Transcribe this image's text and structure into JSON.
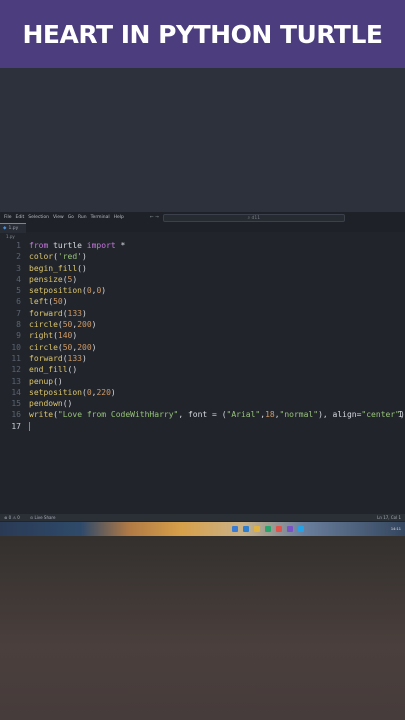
{
  "banner": {
    "title": "HEART IN PYTHON TURTLE"
  },
  "editor": {
    "menu": [
      "File",
      "Edit",
      "Selection",
      "View",
      "Go",
      "Run",
      "Terminal",
      "Help"
    ],
    "command_center": "⌕ d11",
    "tab": "1.py",
    "breadcrumb": "1.py",
    "lines": [
      {
        "n": "1",
        "html": "<span class='kw'>from</span> turtle <span class='kw'>import</span> *"
      },
      {
        "n": "2",
        "html": "<span class='fn'>color</span>(<span class='str'>'red'</span>)"
      },
      {
        "n": "3",
        "html": "<span class='fn'>begin_fill</span>()"
      },
      {
        "n": "4",
        "html": "<span class='fn'>pensize</span>(<span class='num'>5</span>)"
      },
      {
        "n": "5",
        "html": "<span class='fn'>setposition</span>(<span class='num'>0</span>,<span class='num'>0</span>)"
      },
      {
        "n": "6",
        "html": "<span class='fn'>left</span>(<span class='num'>50</span>)"
      },
      {
        "n": "7",
        "html": "<span class='fn'>forward</span>(<span class='num'>133</span>)"
      },
      {
        "n": "8",
        "html": "<span class='fn'>circle</span>(<span class='num'>50</span>,<span class='num'>200</span>)"
      },
      {
        "n": "9",
        "html": "<span class='fn'>right</span>(<span class='num'>140</span>)"
      },
      {
        "n": "10",
        "html": "<span class='fn'>circle</span>(<span class='num'>50</span>,<span class='num'>200</span>)"
      },
      {
        "n": "11",
        "html": "<span class='fn'>forward</span>(<span class='num'>133</span>)"
      },
      {
        "n": "12",
        "html": "<span class='fn'>end_fill</span>()"
      },
      {
        "n": "13",
        "html": "<span class='fn'>penup</span>()"
      },
      {
        "n": "14",
        "html": "<span class='fn'>setposition</span>(<span class='num'>0</span>,<span class='num'>220</span>)"
      },
      {
        "n": "15",
        "html": "<span class='fn'>pendown</span>()"
      },
      {
        "n": "16",
        "html": "<span class='fn'>write</span>(<span class='str'>\"Love from CodeWithHarry\"</span>, font = (<span class='str'>\"Arial\"</span>,<span class='num'>18</span>,<span class='str'>\"normal\"</span>), align=<span class='str'>\"center\"</span>)"
      },
      {
        "n": "17",
        "html": ""
      }
    ],
    "status": {
      "left": "⊗ 0 ⚠ 0",
      "mid": "⊙ Live Share",
      "right": "Ln 17, Col 1"
    },
    "taskbar_time": "14:11"
  }
}
